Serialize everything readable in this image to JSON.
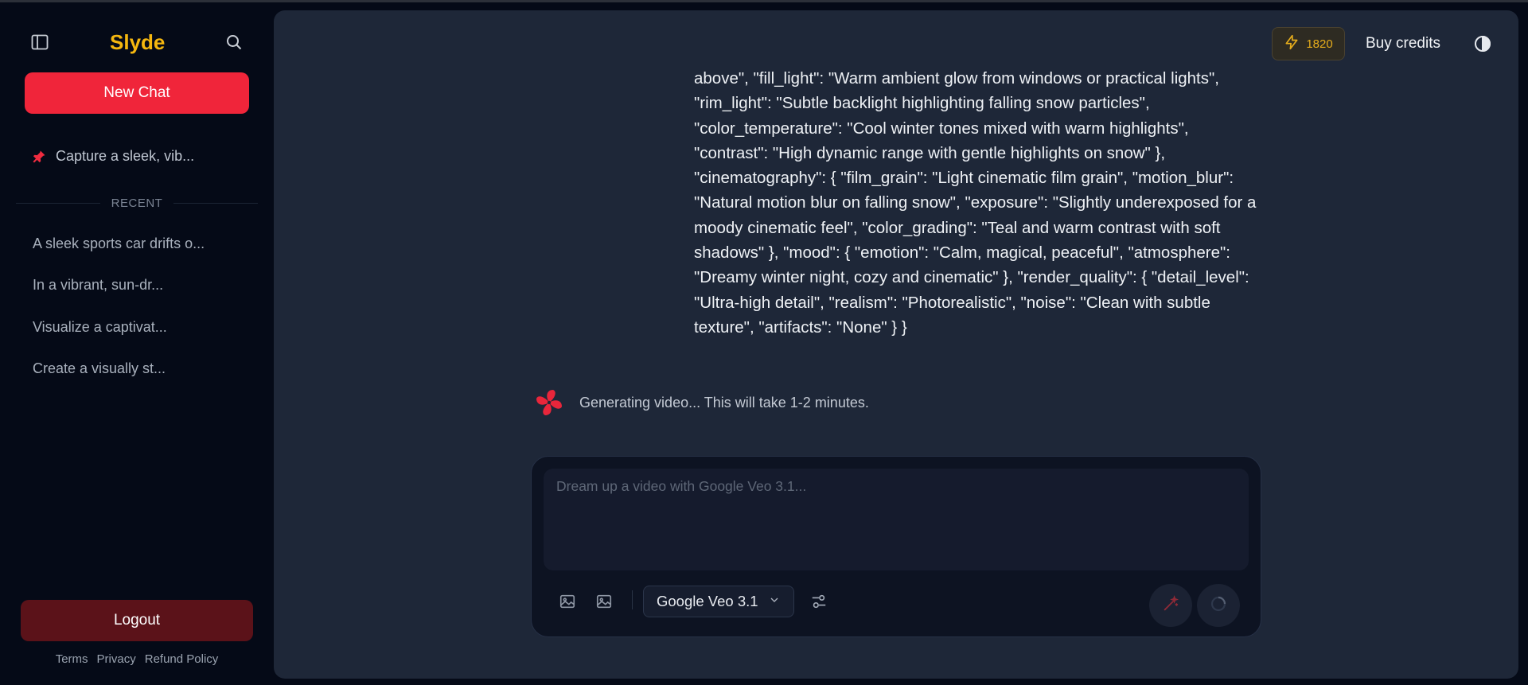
{
  "app": {
    "name": "Slyde"
  },
  "sidebar": {
    "new_chat_label": "New Chat",
    "pinned_item": "Capture a sleek, vib...",
    "recent_label": "RECENT",
    "history": [
      "A sleek sports car drifts o...",
      "In a vibrant, sun-dr...",
      "Visualize a captivat...",
      "Create a visually st..."
    ],
    "logout_label": "Logout",
    "footer_links": [
      "Terms",
      "Privacy",
      "Refund Policy"
    ]
  },
  "header": {
    "credits": "1820",
    "buy_credits_label": "Buy credits"
  },
  "chat": {
    "message": "above\", \"fill_light\": \"Warm ambient glow from windows or practical lights\", \"rim_light\": \"Subtle backlight highlighting falling snow particles\", \"color_temperature\": \"Cool winter tones mixed with warm highlights\", \"contrast\": \"High dynamic range with gentle highlights on snow\" }, \"cinematography\": { \"film_grain\": \"Light cinematic film grain\", \"motion_blur\": \"Natural motion blur on falling snow\", \"exposure\": \"Slightly underexposed for a moody cinematic feel\", \"color_grading\": \"Teal and warm contrast with soft shadows\" }, \"mood\": { \"emotion\": \"Calm, magical, peaceful\", \"atmosphere\": \"Dreamy winter night, cozy and cinematic\" }, \"render_quality\": { \"detail_level\": \"Ultra-high detail\", \"realism\": \"Photorealistic\", \"noise\": \"Clean with subtle texture\", \"artifacts\": \"None\" } }",
    "status": "Generating video... This will take 1-2 minutes."
  },
  "composer": {
    "placeholder": "Dream up a video with Google Veo 3.1...",
    "model": "Google Veo 3.1"
  },
  "colors": {
    "brand": "#f5b70f",
    "accent_red": "#f0253a",
    "logout_bg": "#5b1219",
    "panel_bg": "#1e2738",
    "page_bg": "#050a17"
  },
  "icons": {
    "sidebar_toggle": "sidebar-toggle-icon",
    "search": "search-icon",
    "pin": "pin-icon",
    "lightning": "lightning-icon",
    "theme": "theme-toggle-icon",
    "image": "image-icon",
    "settings": "sliders-icon",
    "chevron": "chevron-down-icon",
    "magic": "magic-wand-icon",
    "loading": "loading-icon",
    "pinwheel": "pinwheel-icon"
  }
}
